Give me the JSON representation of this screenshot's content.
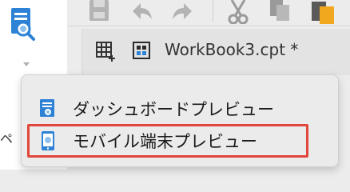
{
  "tab": {
    "label": "WorkBook3.cpt *"
  },
  "preview_menu": {
    "items": [
      {
        "label": "ダッシュボードプレビュー",
        "icon": "dashboard-preview-icon"
      },
      {
        "label": "モバイル端末プレビュー",
        "icon": "mobile-preview-icon"
      }
    ]
  },
  "side_text": "ペ",
  "colors": {
    "accent_blue": "#2d82d6",
    "highlight_red": "#e0463a"
  }
}
